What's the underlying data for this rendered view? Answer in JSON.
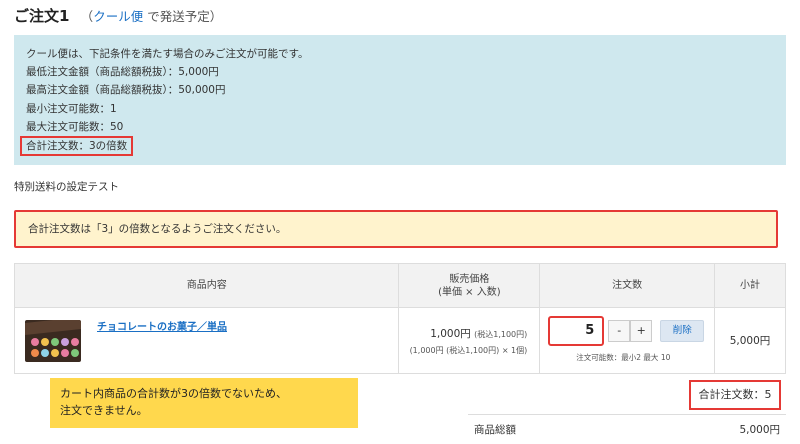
{
  "order": {
    "title": "ご注文1",
    "paren_open": "（",
    "shipping_link": "クール便",
    "shipping_suffix": "で発送予定）"
  },
  "info": {
    "lines": [
      "クール便は、下記条件を満たす場合のみご注文が可能です。",
      "最低注文金額（商品総額税抜）：5,000円",
      "最高注文金額（商品総額税抜）：50,000円",
      "最小注文可能数：1",
      "最大注文可能数：50"
    ],
    "highlight_line": "合計注文数：3の倍数"
  },
  "section_label": "特別送料の設定テスト",
  "warning": "合計注文数は「3」の倍数となるようご注文ください。",
  "table": {
    "headers": {
      "product": "商品内容",
      "price_line1": "販売価格",
      "price_line2": "(単価 × 入数)",
      "qty": "注文数",
      "subtotal": "小計"
    },
    "rows": [
      {
        "name": "チョコレートのお菓子／単品",
        "price": "1,000円",
        "price_tax": "(税込1,100円)",
        "price_detail": "(1,000円 (税込1,100円) × 1個)",
        "qty": "5",
        "minus": "-",
        "plus": "+",
        "delete": "削除",
        "qty_note": "注文可能数：最小2 最大 10",
        "subtotal": "5,000円"
      }
    ]
  },
  "error_note": {
    "line1": "カート内商品の合計数が3の倍数でないため、",
    "line2": "注文できません。"
  },
  "total_qty": "合計注文数：5",
  "summary": {
    "label": "商品総額",
    "value": "5,000円"
  },
  "colors": {
    "info_bg": "#cfe8ee",
    "warning_bg": "#fff3cd",
    "error_border": "#e53935",
    "note_bg": "#ffd84d",
    "link": "#1a6fc4"
  }
}
